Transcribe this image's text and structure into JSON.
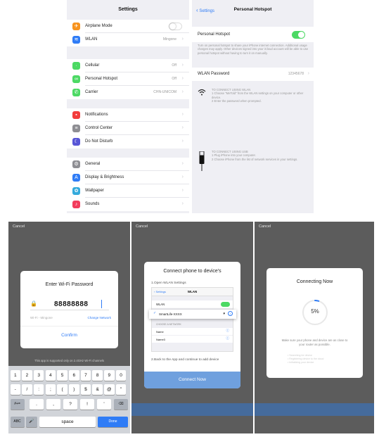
{
  "settings": {
    "title": "Settings",
    "rows": [
      {
        "label": "Airplane Mode",
        "value": "",
        "icon": "airplane-icon",
        "color": "#f7931e"
      },
      {
        "label": "WLAN",
        "value": "Mingone",
        "icon": "wifi-icon",
        "color": "#2f7cf6"
      },
      {
        "label": "Cellular",
        "value": "Off",
        "icon": "cellular-icon",
        "color": "#4cd964"
      },
      {
        "label": "Personal Hotspot",
        "value": "Off",
        "icon": "hotspot-icon",
        "color": "#4cd964"
      },
      {
        "label": "Carrier",
        "value": "CHN-UNICOM",
        "icon": "phone-icon",
        "color": "#4cd964"
      },
      {
        "label": "Notifications",
        "value": "",
        "icon": "notifications-icon",
        "color": "#f23c3c"
      },
      {
        "label": "Control Center",
        "value": "",
        "icon": "control-center-icon",
        "color": "#8e8e93"
      },
      {
        "label": "Do Not Disturb",
        "value": "",
        "icon": "moon-icon",
        "color": "#5856d6"
      },
      {
        "label": "General",
        "value": "",
        "icon": "gear-icon",
        "color": "#8e8e93"
      },
      {
        "label": "Display & Brightness",
        "value": "",
        "icon": "display-icon",
        "color": "#2f7cf6"
      },
      {
        "label": "Wallpaper",
        "value": "",
        "icon": "wallpaper-icon",
        "color": "#34aadc"
      },
      {
        "label": "Sounds",
        "value": "",
        "icon": "sounds-icon",
        "color": "#f23c5c"
      }
    ]
  },
  "hotspot": {
    "back_label": "Settings",
    "title": "Personal Hotspot",
    "toggle_label": "Personal Hotspot",
    "toggle_state": "on",
    "description": "Turn on personal hotspot to share your iPhone internet connection. Additional usage charges may apply. Other devices signed into your iCloud account will be able to use personal hotspot without having to turn it on manually.",
    "password_label": "WLAN Password",
    "password_value": "12345678",
    "wlan_heading": "TO CONNECT USING WLAN",
    "wlan_step1": "1 Choose \"MeTold\" from the WLAN settings on your computer or other device.",
    "wlan_step2": "2 Enter the password when prompted.",
    "usb_heading": "TO CONNECT USING USB",
    "usb_step1": "1 Plug iPhone into your computer.",
    "usb_step2": "2 Choose iPhone from the list of network services in your settings."
  },
  "screen1": {
    "cancel": "Cancel",
    "dialog_title": "Enter Wi-Fi Password",
    "password": "88888888",
    "network_label": "Wi-Fi - Mingone",
    "change_network": "Change Network",
    "confirm": "Confirm",
    "note": "This app is supported only on 2.4GHz Wi-Fi channels",
    "keyboard": {
      "row1": [
        "1",
        "2",
        "3",
        "4",
        "5",
        "6",
        "7",
        "8",
        "9",
        "0"
      ],
      "row2": [
        "-",
        "/",
        ":",
        ";",
        "(",
        ")",
        "$",
        "&",
        "@",
        "\""
      ],
      "row3": [
        "#+=",
        ".",
        ",",
        "?",
        "!",
        "'",
        "⌫"
      ],
      "abc": "ABC",
      "space": "space",
      "done": "Done"
    }
  },
  "screen2": {
    "cancel": "Cancel",
    "title": "Connect phone to device's",
    "step1": "1.Open WLAN Settings",
    "mini_back": "Settings",
    "mini_title": "WLAN",
    "mini_wlan": "WLAN",
    "mini_network": "SmartLife-XXXX",
    "mini_choose": "CHOOSE A NETWORK",
    "mini_net2": "Name",
    "mini_net3": "Name3",
    "step2": "2.Back to the App and continue to add device",
    "button": "Connect Now"
  },
  "screen3": {
    "cancel": "Cancel",
    "title": "Connecting Now",
    "percent": "5%",
    "progress": 0.05,
    "hint": "Make sure your phone and device are as close to your router as possible.",
    "steps": [
      "Searching for device",
      "Registering device to the cloud",
      "Initializing your device"
    ]
  },
  "colors": {
    "accent": "#2f7cf6",
    "toggle_on": "#4cd964",
    "overlay": "#5c5c5c"
  }
}
